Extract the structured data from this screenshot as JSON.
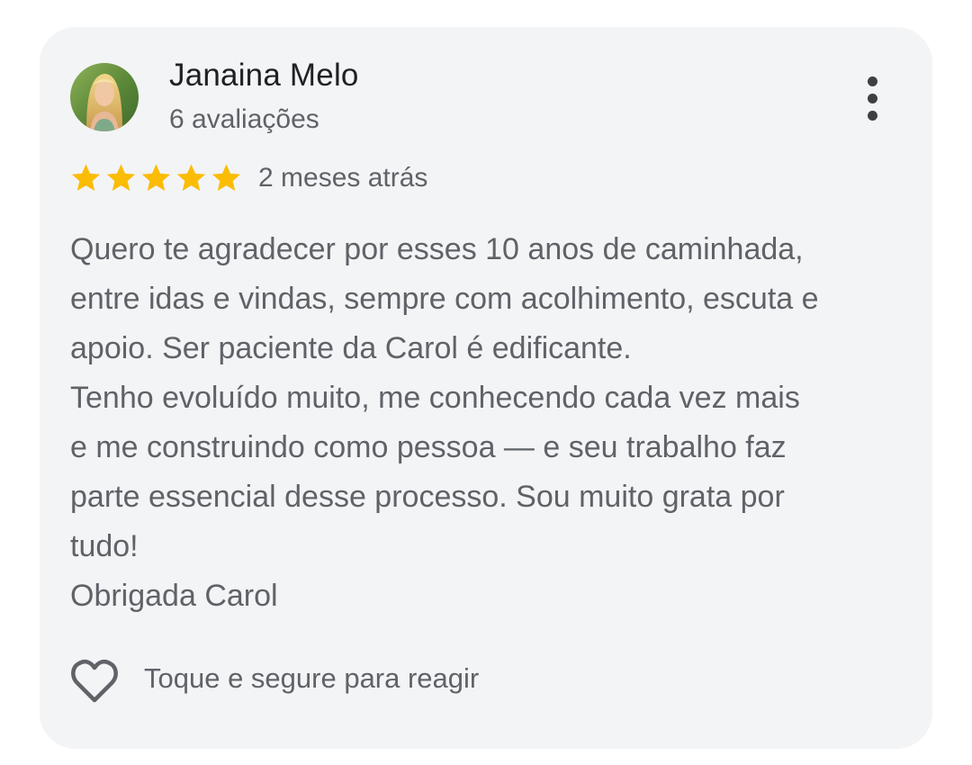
{
  "review": {
    "author_name": "Janaina Melo",
    "author_meta": "6 avaliações",
    "rating": 5,
    "rating_max": 5,
    "time_ago": "2 meses atrás",
    "text_lines": [
      "Quero te agradecer por esses 10 anos de caminhada,",
      "entre idas e vindas, sempre com acolhimento, escuta e",
      "apoio. Ser paciente da Carol é edificante.",
      "Tenho evoluído muito, me conhecendo cada vez mais",
      "e me construindo como pessoa — e seu trabalho faz",
      "parte essencial desse processo. Sou muito grata por",
      "tudo!",
      "Obrigada Carol"
    ],
    "react_hint": "Toque e segure para reagir"
  },
  "icons": {
    "more": "more-vert-icon",
    "star": "star-icon",
    "heart": "heart-outline-icon"
  },
  "colors": {
    "card_background": "#f3f4f6",
    "star": "#fbbc04",
    "primary_text": "#202124",
    "secondary_text": "#5f6368"
  }
}
